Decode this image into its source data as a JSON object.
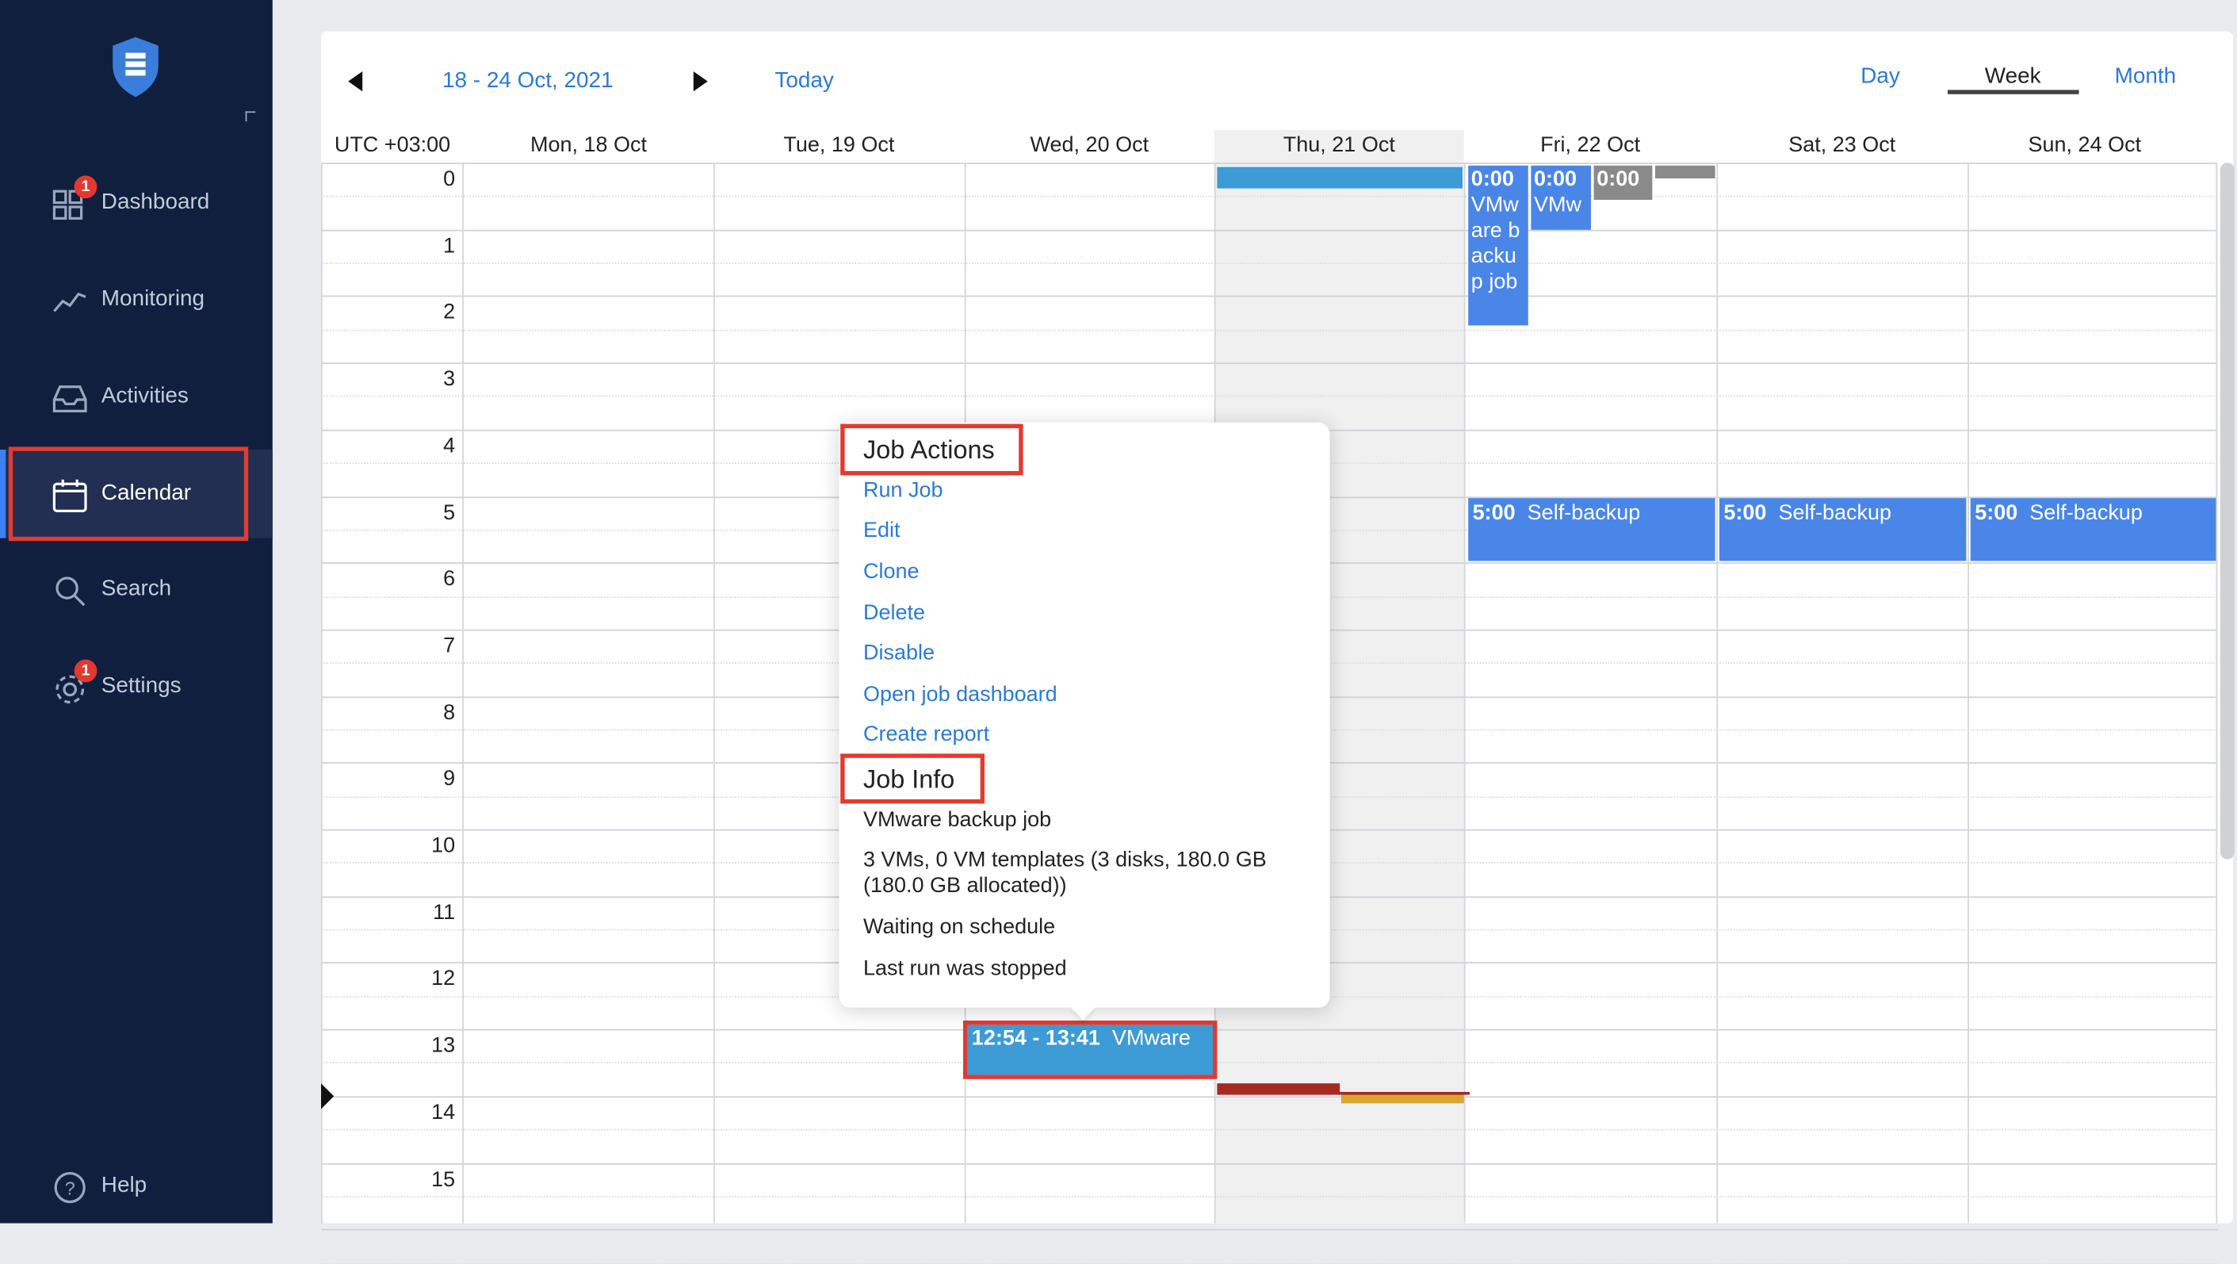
{
  "sidebar": {
    "items": [
      {
        "label": "Dashboard",
        "icon": "dashboard-icon",
        "badge": "1"
      },
      {
        "label": "Monitoring",
        "icon": "monitoring-icon"
      },
      {
        "label": "Activities",
        "icon": "inbox-icon"
      },
      {
        "label": "Calendar",
        "icon": "calendar-icon",
        "active": true
      },
      {
        "label": "Search",
        "icon": "search-icon"
      },
      {
        "label": "Settings",
        "icon": "gear-icon",
        "badge": "1"
      }
    ],
    "help_label": "Help"
  },
  "header": {
    "range": "18 - 24 Oct, 2021",
    "today": "Today",
    "views": {
      "day": "Day",
      "week": "Week",
      "month": "Month",
      "selected": "Week"
    }
  },
  "calendar": {
    "timezone": "UTC +03:00",
    "days": [
      "Mon, 18 Oct",
      "Tue, 19 Oct",
      "Wed, 20 Oct",
      "Thu, 21 Oct",
      "Fri, 22 Oct",
      "Sat, 23 Oct",
      "Sun, 24 Oct"
    ],
    "today_index": 3,
    "hours": [
      "0",
      "1",
      "2",
      "3",
      "4",
      "5",
      "6",
      "7",
      "8",
      "9",
      "10",
      "11",
      "12",
      "13",
      "14",
      "15"
    ],
    "events": {
      "fri_a_time": "0:00",
      "fri_a_title": "VMware backup job",
      "fri_b_time": "0:00",
      "fri_b_title": "VMw",
      "fri_c_time": "0:00",
      "self_time": "5:00",
      "self_title": "Self-backup",
      "wed_time": "12:54 - 13:41",
      "wed_title": "VMware"
    }
  },
  "popup": {
    "actions_title": "Job Actions",
    "actions": [
      "Run Job",
      "Edit",
      "Clone",
      "Delete",
      "Disable",
      "Open job dashboard",
      "Create report"
    ],
    "info_title": "Job Info",
    "info": [
      "VMware backup job",
      "3 VMs, 0 VM templates (3 disks, 180.0 GB (180.0 GB allocated))",
      "Waiting on schedule",
      "Last run was stopped"
    ]
  },
  "colors": {
    "sidebar_bg": "#0f1f3d",
    "accent": "#2a7ad6",
    "event_blue": "#4a86e8",
    "event_teal": "#3d9bd6",
    "highlight": "#e23b2e"
  }
}
